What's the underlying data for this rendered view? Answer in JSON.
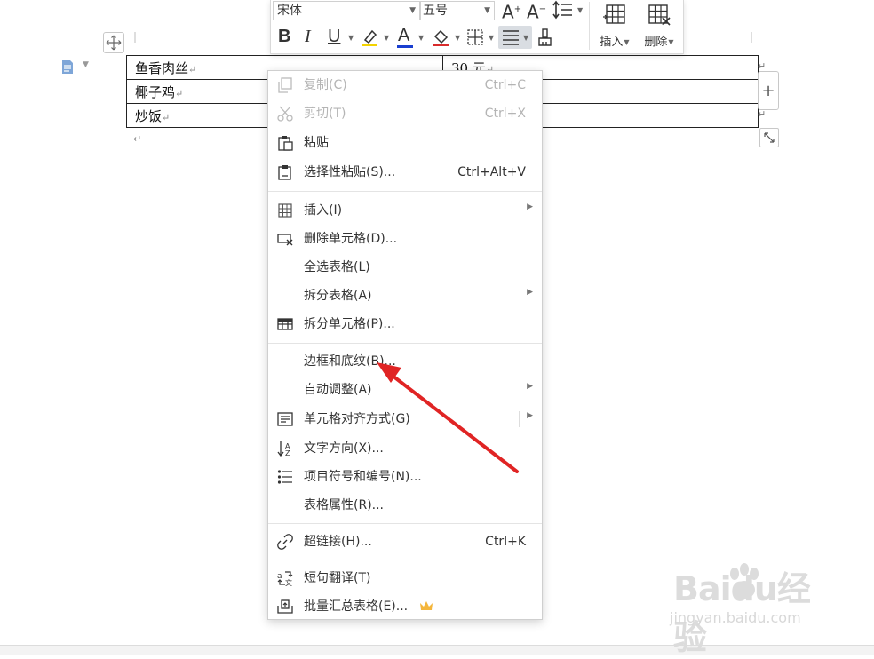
{
  "toolbar": {
    "font_name": "宋体",
    "font_size": "五号",
    "insert_label": "插入",
    "delete_label": "删除",
    "colors": {
      "font_color_underline": "#1a3fd0",
      "highlight": "#f3d300",
      "shading": "#d92b2b"
    }
  },
  "table": {
    "rows": [
      {
        "c1": "鱼香肉丝",
        "c2": "30 元"
      },
      {
        "c1": "椰子鸡",
        "c2": ""
      },
      {
        "c1": "炒饭",
        "c2": ""
      }
    ],
    "para_mark": "↵"
  },
  "menu": {
    "items": [
      {
        "label": "复制(C)",
        "shortcut": "Ctrl+C",
        "icon": "copy-icon"
      },
      {
        "label": "剪切(T)",
        "shortcut": "Ctrl+X",
        "icon": "cut-icon"
      },
      {
        "label": "粘贴",
        "shortcut": "",
        "icon": "paste-icon"
      },
      {
        "label": "选择性粘贴(S)...",
        "shortcut": "Ctrl+Alt+V",
        "icon": "paste-special-icon"
      },
      {
        "label": "插入(I)",
        "icon": "insert-table-icon"
      },
      {
        "label": "删除单元格(D)...",
        "icon": "delete-cell-icon"
      },
      {
        "label": "全选表格(L)"
      },
      {
        "label": "拆分表格(A)"
      },
      {
        "label": "拆分单元格(P)...",
        "icon": "split-cell-icon"
      },
      {
        "label": "边框和底纹(B)..."
      },
      {
        "label": "自动调整(A)"
      },
      {
        "label": "单元格对齐方式(G)",
        "icon": "cell-align-icon"
      },
      {
        "label": "文字方向(X)...",
        "icon": "text-direction-icon"
      },
      {
        "label": "项目符号和编号(N)...",
        "icon": "bullet-list-icon"
      },
      {
        "label": "表格属性(R)..."
      },
      {
        "label": "超链接(H)...",
        "shortcut": "Ctrl+K",
        "icon": "hyperlink-icon"
      },
      {
        "label": "短句翻译(T)",
        "icon": "translate-icon"
      },
      {
        "label": "批量汇总表格(E)...",
        "icon": "batch-summary-icon"
      }
    ]
  },
  "watermark": {
    "brand": "Baidu经验",
    "url": "jingyan.baidu.com"
  },
  "annotation": {
    "arrow_color": "#e02424"
  }
}
